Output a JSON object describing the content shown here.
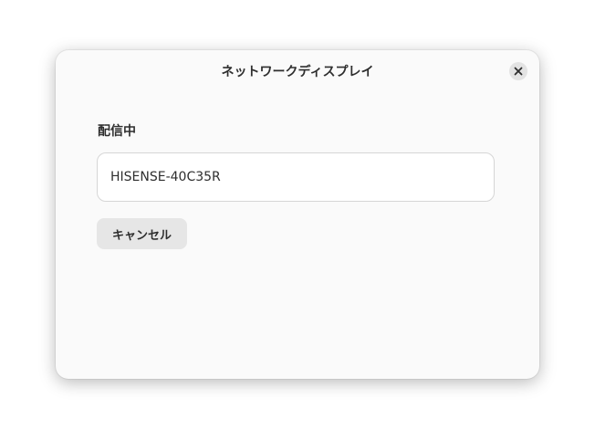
{
  "dialog": {
    "title": "ネットワークディスプレイ",
    "close_icon": "close-icon"
  },
  "content": {
    "section_label": "配信中",
    "device_name": "HISENSE-40C35R",
    "cancel_label": "キャンセル"
  },
  "colors": {
    "dialog_bg": "#fafafa",
    "text": "#2e2e2e",
    "button_bg": "#e6e6e6",
    "close_bg": "#e3e3e3"
  }
}
